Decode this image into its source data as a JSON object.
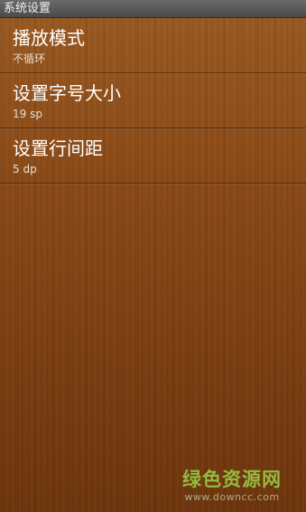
{
  "window": {
    "title": "系统设置"
  },
  "preferences": [
    {
      "title": "播放模式",
      "summary": "不循环"
    },
    {
      "title": "设置字号大小",
      "summary": "19 sp"
    },
    {
      "title": "设置行间距",
      "summary": "5 dp"
    }
  ],
  "watermark": {
    "title": "绿色资源网",
    "url": "www.downcc.com"
  },
  "colors": {
    "background": "#7a3f10",
    "title_bar": "#4a4a4a",
    "title_text": "#f0f0f0",
    "watermark": "#9bd24a"
  }
}
